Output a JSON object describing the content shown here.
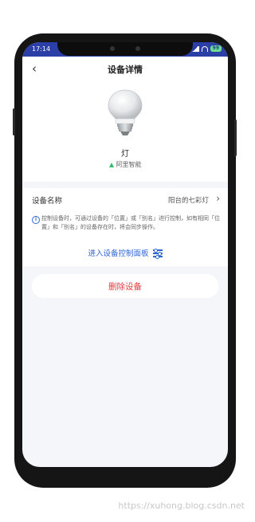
{
  "status_bar": {
    "time": "17:14",
    "battery": "99"
  },
  "header": {
    "title": "设备详情"
  },
  "device": {
    "name": "灯",
    "brand": "阿里智能"
  },
  "name_row": {
    "label": "设备名称",
    "value": "阳台的七彩灯"
  },
  "info": {
    "text": "控制设备时，可通过设备的「位置」或「别名」进行控制，如有相同「位置」和「别名」的设备存在时，将会同步操作。"
  },
  "panel_link": {
    "label": "进入设备控制面板"
  },
  "delete": {
    "label": "删除设备"
  },
  "watermark": "https://xuhong.blog.csdn.net",
  "colors": {
    "accent": "#2f67d6",
    "danger": "#e53b3b",
    "statusbar": "#2b3fa6",
    "brand": "#2ebf6b"
  }
}
